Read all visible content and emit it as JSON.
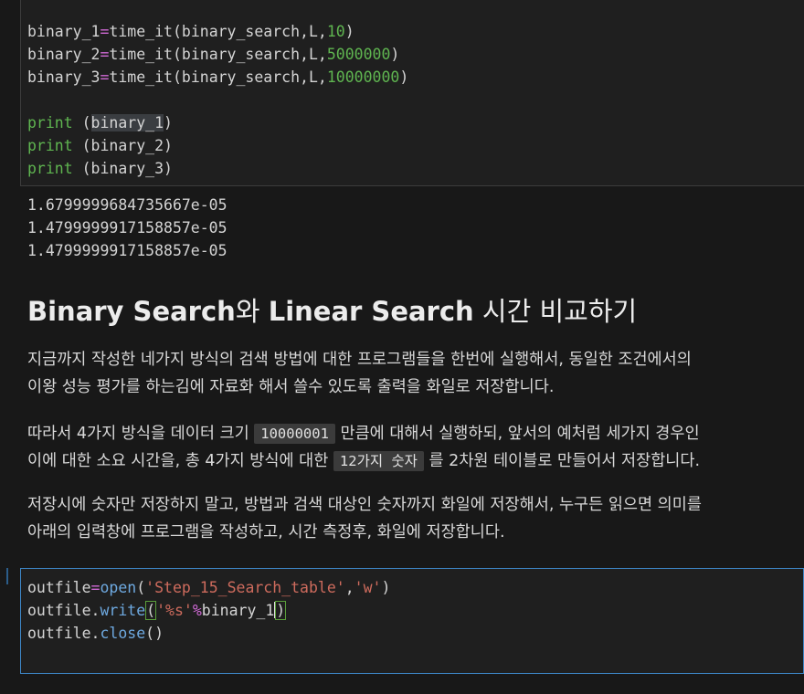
{
  "cell1": {
    "lines": [
      {
        "var": "binary_1",
        "op": "=",
        "call": "time_it(binary_search,L,",
        "num": "10",
        "close": ")"
      },
      {
        "var": "binary_2",
        "op": "=",
        "call": "time_it(binary_search,L,",
        "num": "5000000",
        "close": ")"
      },
      {
        "var": "binary_3",
        "op": "=",
        "call": "time_it(binary_search,L,",
        "num": "10000000",
        "close": ")"
      }
    ],
    "prints": [
      {
        "kw": "print",
        "open": " (",
        "arg": "binary_1",
        "close": ")"
      },
      {
        "kw": "print",
        "open": " (",
        "arg": "binary_2",
        "close": ")"
      },
      {
        "kw": "print",
        "open": " (",
        "arg": "binary_3",
        "close": ")"
      }
    ]
  },
  "output": [
    "1.6799999684735667e-05",
    "1.4799999917158857e-05",
    "1.4799999917158857e-05"
  ],
  "markdown": {
    "heading_a": "Binary Search",
    "heading_b": "와 ",
    "heading_c": "Linear Search",
    "heading_d": " 시간 비교하기",
    "p1_l1": "지금까지 작성한 네가지 방식의 검색 방법에 대한 프로그램들을 한번에 실행해서, 동일한 조건에서의",
    "p1_l2": "이왕 성능 평가를 하는김에 자료화 해서 쓸수 있도록 출력을 화일로 저장합니다.",
    "p2_l1a": "따라서 4가지 방식을 데이터 크기 ",
    "p2_code1": "10000001",
    "p2_l1b": " 만큼에 대해서 실행하되, 앞서의 예처럼 세가지 경우인",
    "p2_l2a": "이에 대한 소요 시간을, 총 4가지 방식에 대한 ",
    "p2_code2": "12가지 숫자",
    "p2_l2b": " 를 2차원 테이블로 만들어서 저장합니다.",
    "p3_l1": "저장시에 숫자만 저장하지 말고, 방법과 검색 대상인 숫자까지 화일에 저장해서, 누구든 읽으면 의미를",
    "p3_l2": "아래의 입력창에 프로그램을 작성하고, 시간 측정후, 화일에 저장합니다."
  },
  "cell2": {
    "l1_var": "outfile",
    "l1_op": "=",
    "l1_fn": "open",
    "l1_p": "(",
    "l1_s1": "'Step_15_Search_table'",
    "l1_c": ",",
    "l1_s2": "'w'",
    "l1_e": ")",
    "l2_obj": "outfile.",
    "l2_fn": "write",
    "l2_p": "(",
    "l2_s": "'%s'",
    "l2_op": "%",
    "l2_arg": "binary_1",
    "l2_e": ")",
    "l3_obj": "outfile.",
    "l3_fn": "close",
    "l3_e": "()"
  }
}
